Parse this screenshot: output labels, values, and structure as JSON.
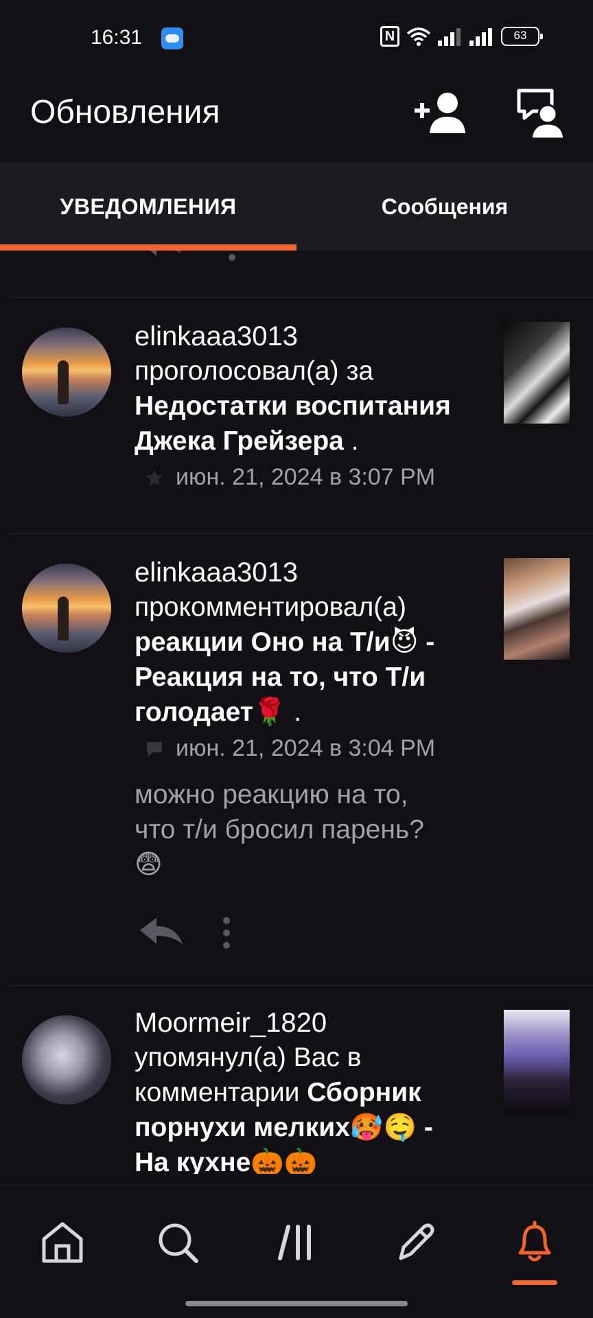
{
  "status_bar": {
    "time": "16:31",
    "battery": "63"
  },
  "header": {
    "title": "Обновления"
  },
  "tabs": [
    {
      "label": "УВЕДОМЛЕНИЯ",
      "active": true
    },
    {
      "label": "Сообщения",
      "active": false
    }
  ],
  "notifications": [
    {
      "user": "elinkaaa3013",
      "line1": "проголосовал(а) за",
      "line2": "Недостатки воспитания",
      "line3": "Джека Грейзера",
      "line3_tail": " .",
      "meta_icon": "star-icon",
      "date": "июн. 21, 2024 в 3:07 PM"
    },
    {
      "user": "elinkaaa3013",
      "line1": "прокомментировал(а)",
      "line2": "реакции Оно на Т/и😈 -",
      "line3": "Реакция на то, что Т/и",
      "line4": "голодает🌹",
      "line4_tail": " .",
      "meta_icon": "comment-icon",
      "date": "июн. 21, 2024 в 3:04 PM",
      "comment_line1": "можно реакцию на то,",
      "comment_line2": "что т/и бросил парень?",
      "comment_line3": "😨"
    },
    {
      "user": "Moormeir_1820",
      "line1": "упомянул(а) Вас в",
      "line2_plain": "комментарии ",
      "line2_bold": "Сборник",
      "line3": "порнухи мелких🥵🤤 -",
      "line4": "На кухне🎃🎃"
    }
  ],
  "nav": [
    "home-icon",
    "search-icon",
    "library-icon",
    "write-icon",
    "notifications-bell-icon"
  ],
  "colors": {
    "accent": "#f2652e",
    "background": "#121014",
    "tabs_bg": "#1c1b1f",
    "secondary_text": "#a3a1a8"
  }
}
